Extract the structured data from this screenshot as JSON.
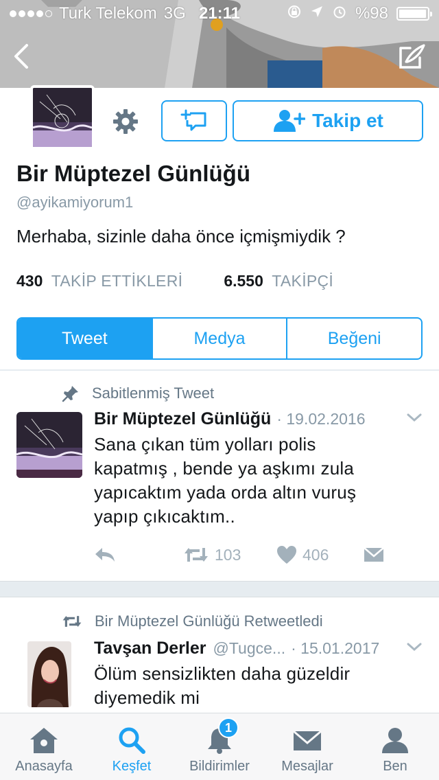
{
  "status_bar": {
    "carrier": "Turk Telekom",
    "network": "3G",
    "time": "21:11",
    "battery": "%98",
    "battery_level": 0.98
  },
  "profile": {
    "name": "Bir Müptezel Günlüğü",
    "handle": "@ayikamiyorum1",
    "bio": "Merhaba, sizinle daha önce içmişmiydik ?",
    "follow_label": "Takip et",
    "following_count": "430",
    "following_label": "TAKİP ETTİKLERİ",
    "followers_count": "6.550",
    "followers_label": "TAKİPÇİ"
  },
  "tabs": [
    {
      "label": "Tweet",
      "active": true
    },
    {
      "label": "Medya",
      "active": false
    },
    {
      "label": "Beğeni",
      "active": false
    }
  ],
  "tweets": [
    {
      "context": "Sabitlenmiş Tweet",
      "author": "Bir Müptezel Günlüğü",
      "handle": "",
      "date": "· 19.02.2016",
      "text_lines": [
        "Sana çıkan tüm yolları polis",
        "kapatmış , bende ya aşkımı zula",
        "yapıcaktım yada orda altın vuruş",
        "yapıp çıkıcaktım.."
      ],
      "retweets": "103",
      "likes": "406"
    },
    {
      "context": "Bir Müptezel Günlüğü Retweetledi",
      "author": "Tavşan Derler",
      "handle": "@Tugce...",
      "date": "· 15.01.2017",
      "text_lines": [
        "Ölüm sensizlikten daha güzeldir",
        "diyemedik mi"
      ]
    }
  ],
  "tabbar": [
    {
      "label": "Anasayfa",
      "icon": "home-icon"
    },
    {
      "label": "Keşfet",
      "icon": "search-icon",
      "active": true
    },
    {
      "label": "Bildirimler",
      "icon": "bell-icon",
      "badge": "1"
    },
    {
      "label": "Mesajlar",
      "icon": "envelope-icon"
    },
    {
      "label": "Ben",
      "icon": "person-icon"
    }
  ],
  "colors": {
    "accent": "#1da1f2",
    "muted": "#8899a6",
    "divider": "#e6ecf0"
  }
}
